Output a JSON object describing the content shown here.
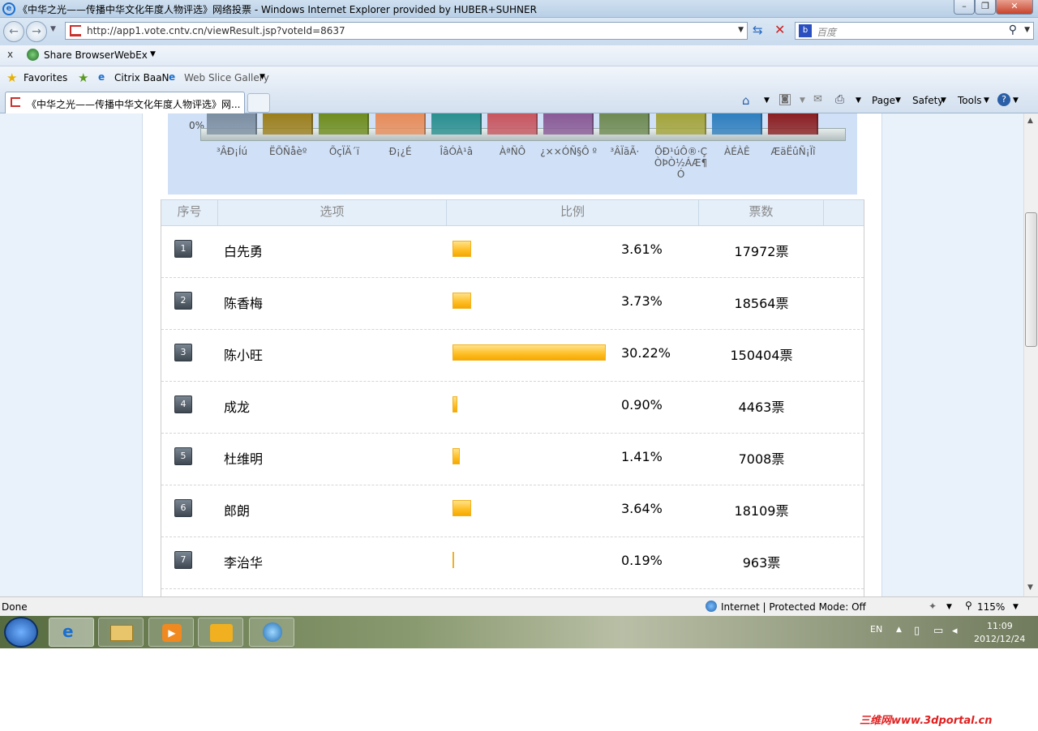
{
  "window": {
    "title": "《中华之光——传播中华文化年度人物评选》网络投票 - Windows Internet Explorer provided by HUBER+SUHNER"
  },
  "address": {
    "url": "http://app1.vote.cntv.cn/viewResult.jsp?voteId=8637",
    "search_placeholder": "百度"
  },
  "links_bar": {
    "close": "x",
    "share": "Share Browser",
    "webex": "WebEx"
  },
  "favorites_bar": {
    "favorites": "Favorites",
    "citrix": "Citrix BaaN",
    "webslice": "Web Slice Gallery"
  },
  "tab": {
    "title": "《中华之光——传播中华文化年度人物评选》网..."
  },
  "commands": {
    "page": "Page",
    "safety": "Safety",
    "tools": "Tools"
  },
  "chart_data": {
    "type": "bar",
    "categories": [
      "³ÂÐ¡Íú",
      "ËÕÑåèº",
      "ÕçÏÄ´ï",
      "Ð¡¿É",
      "ÎâÓÀ¹â",
      "ÀªÑÔ",
      "¿××ÓÑ§Ô º",
      "³ÂÏãÃ·",
      "ÖÐ¹úÔ®·ÇÒÞÒ½ÁÆ¶Ó",
      "ÀÉÀÊ",
      "ÆäËûÑ¡Ïî"
    ],
    "colors": [
      "#7d8fa2",
      "#9c7f1c",
      "#6f8d1e",
      "#e88d5a",
      "#2a8f8f",
      "#c8565f",
      "#8a5a96",
      "#6f8a52",
      "#a4a43a",
      "#2f7fbf",
      "#8b1f22"
    ],
    "ytick": "0%"
  },
  "table": {
    "headers": {
      "no": "序号",
      "option": "选项",
      "ratio": "比例",
      "votes": "票数"
    },
    "rows": [
      {
        "no": "1",
        "name": "白先勇",
        "percent": "3.61%",
        "votes": "17972票",
        "ratio": 3.61
      },
      {
        "no": "2",
        "name": "陈香梅",
        "percent": "3.73%",
        "votes": "18564票",
        "ratio": 3.73
      },
      {
        "no": "3",
        "name": "陈小旺",
        "percent": "30.22%",
        "votes": "150404票",
        "ratio": 30.22
      },
      {
        "no": "4",
        "name": "成龙",
        "percent": "0.90%",
        "votes": "4463票",
        "ratio": 0.9
      },
      {
        "no": "5",
        "name": "杜维明",
        "percent": "1.41%",
        "votes": "7008票",
        "ratio": 1.41
      },
      {
        "no": "6",
        "name": "郎朗",
        "percent": "3.64%",
        "votes": "18109票",
        "ratio": 3.64
      },
      {
        "no": "7",
        "name": "李治华",
        "percent": "0.19%",
        "votes": "963票",
        "ratio": 0.19
      }
    ]
  },
  "status": {
    "text": "Done",
    "zone": "Internet | Protected Mode: Off",
    "zoom": "115%"
  },
  "tray": {
    "lang": "EN",
    "time": "11:09",
    "date": "2012/12/24"
  },
  "watermark": "三维网www.3dportal.cn"
}
